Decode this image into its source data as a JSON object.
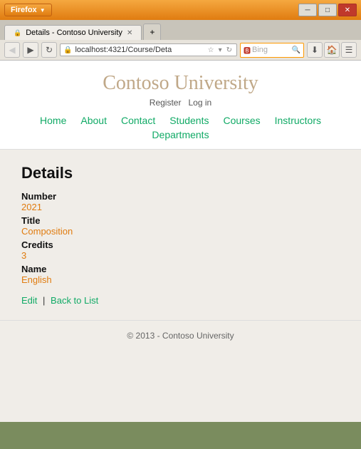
{
  "browser": {
    "firefox_label": "Firefox",
    "tab_title": "Details - Contoso University",
    "address": "localhost:4321/Course/Deta",
    "search_placeholder": "Bing",
    "new_tab_symbol": "+",
    "back_symbol": "◀",
    "forward_symbol": "▶",
    "minimize_symbol": "─",
    "maximize_symbol": "□",
    "close_symbol": "✕"
  },
  "site": {
    "title": "Contoso University",
    "register": "Register",
    "login": "Log in",
    "nav": [
      "Home",
      "About",
      "Contact",
      "Students",
      "Courses",
      "Instructors",
      "Departments"
    ]
  },
  "details": {
    "heading": "Details",
    "fields": [
      {
        "label": "Number",
        "value": "2021"
      },
      {
        "label": "Title",
        "value": "Composition"
      },
      {
        "label": "Credits",
        "value": "3"
      },
      {
        "label": "Name",
        "value": "English"
      }
    ],
    "edit_label": "Edit",
    "back_label": "Back to List"
  },
  "footer": {
    "text": "© 2013 - Contoso University"
  }
}
